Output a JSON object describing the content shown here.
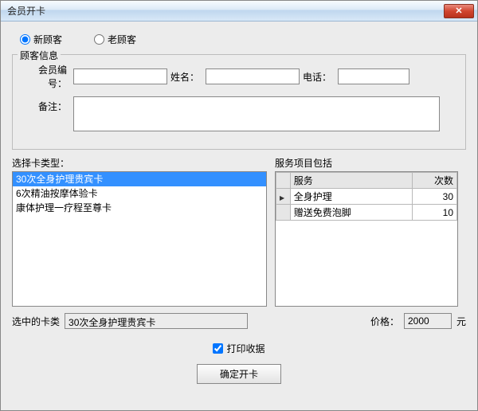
{
  "window": {
    "title": "会员开卡"
  },
  "customer_type": {
    "new": "新顾客",
    "old": "老顾客",
    "selected": "new"
  },
  "customer_info": {
    "legend": "顾客信息",
    "member_id_label": "会员编号：",
    "member_id": "",
    "name_label": "姓名：",
    "name": "",
    "phone_label": "电话：",
    "phone": "",
    "remark_label": "备注：",
    "remark": ""
  },
  "card_select": {
    "label": "选择卡类型：",
    "items": [
      "30次全身护理贵宾卡",
      "6次精油按摩体验卡",
      "康体护理一疗程至尊卡"
    ],
    "selected_index": 0
  },
  "service_table": {
    "label": "服务项目包括",
    "col_service": "服务",
    "col_count": "次数",
    "rows": [
      {
        "service": "全身护理",
        "count": 30
      },
      {
        "service": "赠送免费泡脚",
        "count": 10
      }
    ]
  },
  "selected_card": {
    "label": "选中的卡类",
    "value": "30次全身护理贵宾卡"
  },
  "price": {
    "label": "价格：",
    "value": "2000",
    "unit": "元"
  },
  "print_receipt": {
    "label": "打印收据",
    "checked": true
  },
  "confirm": {
    "label": "确定开卡"
  }
}
